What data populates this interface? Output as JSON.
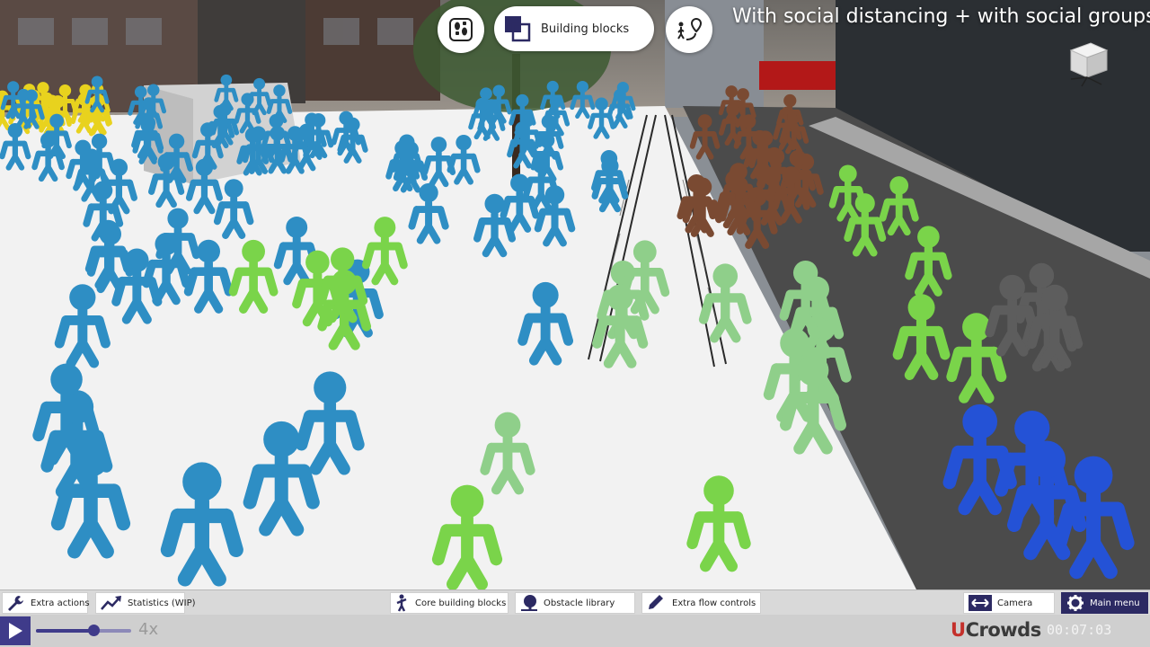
{
  "top_toolbar": {
    "steps_icon": "footsteps-icon",
    "blocks_icon": "building-blocks-icon",
    "blocks_label": "Building blocks",
    "route_icon": "walking-route-icon"
  },
  "scene": {
    "title": "With social distancing + with social groups",
    "colors": {
      "ground": "#f2f2f2",
      "road": "#4b4b4b",
      "crowd_blue": "#2e8ec4",
      "crowd_green": "#7ad44a",
      "crowd_mint": "#8fcf8a",
      "crowd_brown": "#7a4a32",
      "crowd_gray": "#5d5d5d",
      "crowd_royal": "#2452d6",
      "crowd_yellow": "#e8d21e"
    }
  },
  "toolbar": {
    "extra_actions": "Extra actions",
    "statistics": "Statistics (WIP)",
    "core_blocks": "Core building blocks",
    "obstacle_library": "Obstacle library",
    "extra_flow": "Extra flow controls",
    "camera": "Camera",
    "main_menu": "Main menu"
  },
  "playback": {
    "speed_label": "4x",
    "speed_fraction": 0.6,
    "time": "00:07:03",
    "logo_u": "U",
    "logo_rest": "Crowds",
    "accent": "#3f3b8a"
  }
}
